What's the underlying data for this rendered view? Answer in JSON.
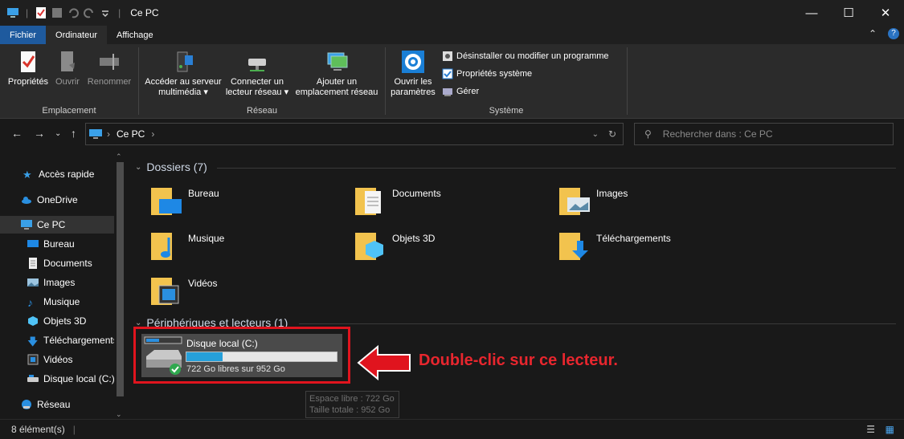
{
  "window": {
    "title": "Ce PC"
  },
  "tabs": {
    "file": "Fichier",
    "computer": "Ordinateur",
    "view": "Affichage"
  },
  "ribbon": {
    "location": {
      "label": "Emplacement",
      "properties": "Propriétés",
      "open": "Ouvrir",
      "rename": "Renommer"
    },
    "network": {
      "label": "Réseau",
      "media_server_l1": "Accéder au serveur",
      "media_server_l2": "multimédia",
      "map_drive_l1": "Connecter un",
      "map_drive_l2": "lecteur réseau",
      "add_location_l1": "Ajouter un",
      "add_location_l2": "emplacement réseau"
    },
    "system": {
      "label": "Système",
      "open_settings_l1": "Ouvrir les",
      "open_settings_l2": "paramètres",
      "uninstall": "Désinstaller ou modifier un programme",
      "system_properties": "Propriétés système",
      "manage": "Gérer"
    }
  },
  "address": {
    "crumb": "Ce PC",
    "search_placeholder": "Rechercher dans : Ce PC"
  },
  "nav": {
    "quick_access": "Accès rapide",
    "onedrive": "OneDrive",
    "this_pc": "Ce PC",
    "desktop": "Bureau",
    "documents": "Documents",
    "pictures": "Images",
    "music": "Musique",
    "objects3d": "Objets 3D",
    "downloads": "Téléchargements",
    "videos": "Vidéos",
    "local_disk": "Disque local (C:)",
    "network": "Réseau"
  },
  "folders_section": {
    "title": "Dossiers (7)"
  },
  "folders": [
    "Bureau",
    "Documents",
    "Images",
    "Musique",
    "Objets 3D",
    "Téléchargements",
    "Vidéos"
  ],
  "devices_section": {
    "title": "Périphériques et lecteurs (1)"
  },
  "drive": {
    "name": "Disque local (C:)",
    "free_text": "722 Go libres sur 952 Go",
    "used_fraction": 0.24
  },
  "tooltip": {
    "line1": "Espace libre : 722 Go",
    "line2": "Taille totale : 952 Go"
  },
  "annotation": {
    "text": "Double-clic sur ce lecteur."
  },
  "status": {
    "count": "8 élément(s)"
  },
  "colors": {
    "accent": "#1e5a9e",
    "highlight_red": "#e0141e",
    "drive_bar": "#26a0da"
  }
}
